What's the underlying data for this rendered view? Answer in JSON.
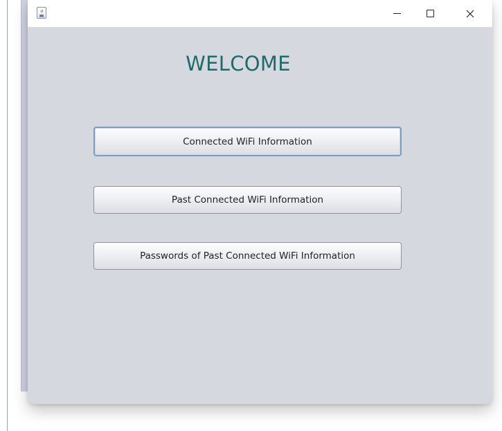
{
  "window": {
    "title_icon": "java-coffee-icon",
    "controls": {
      "minimize": "minimize-icon",
      "maximize": "maximize-icon",
      "close": "close-icon",
      "close_glyph": "✕"
    }
  },
  "main": {
    "heading": "WELCOME",
    "heading_color": "#1f6a6a",
    "buttons": [
      {
        "label": "Connected WiFi Information"
      },
      {
        "label": "Past Connected WiFi Information"
      },
      {
        "label": "Passwords of Past Connected WiFi Information"
      }
    ]
  }
}
